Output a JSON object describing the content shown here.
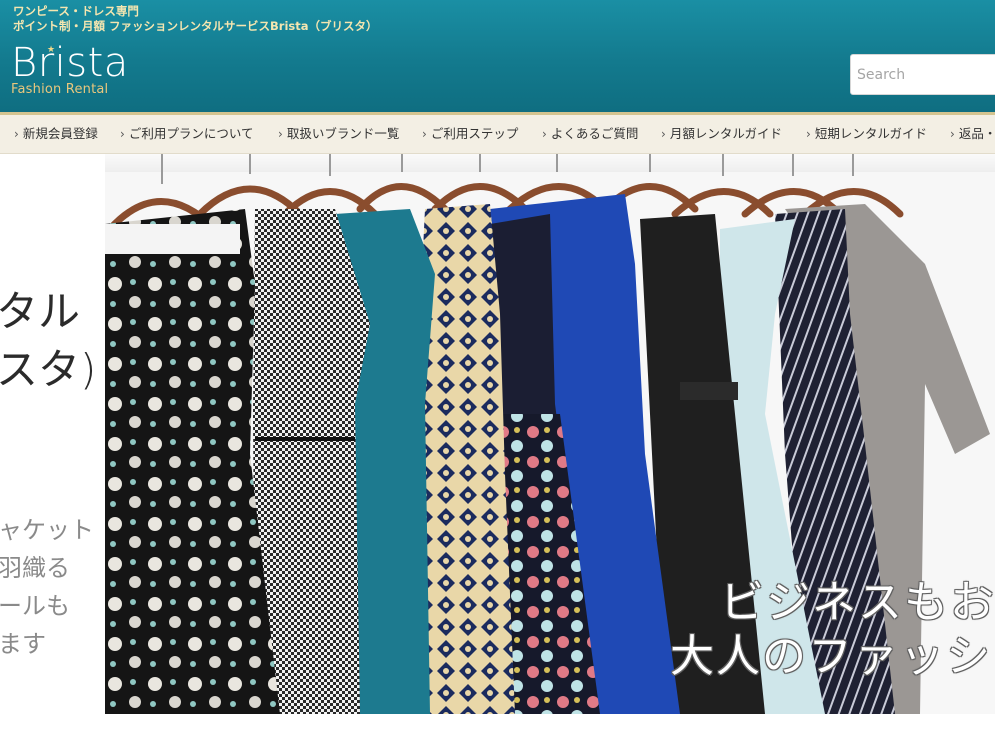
{
  "header": {
    "tagline_line1": "ワンピース・ドレス専門",
    "tagline_line2": "ポイント制・月額 ファッションレンタルサービスBrista（ブリスタ）",
    "logo_name": "Brista",
    "logo_subtitle": "Fashion Rental",
    "search_placeholder": "Search"
  },
  "nav": {
    "items": [
      {
        "label": "新規会員登録"
      },
      {
        "label": "ご利用プランについて"
      },
      {
        "label": "取扱いブランド一覧"
      },
      {
        "label": "ご利用ステップ"
      },
      {
        "label": "よくあるご質問"
      },
      {
        "label": "月額レンタルガイド"
      },
      {
        "label": "短期レンタルガイド"
      },
      {
        "label": "返品・"
      }
    ],
    "chevron": "›"
  },
  "left_copy": {
    "line1": "タル",
    "line2": "スタ)",
    "line3": "ャケット",
    "line4": "羽織る",
    "line5": "ールも",
    "line6": "ます"
  },
  "hero": {
    "overlay_line1": "ビジネスもお",
    "overlay_line2": "大人のファッシ",
    "dress_colors": [
      "#1b1b1b",
      "#e8e8e8",
      "#1d7a8f",
      "#1c2a5e",
      "#1b1e33",
      "#1f49b5",
      "#1f1f1f",
      "#cfe6ea",
      "#242638",
      "#9a9694"
    ]
  },
  "colors": {
    "header_bg": "#137a8e",
    "tagline": "#f5e6b0",
    "logo_subtitle": "#e9c77d",
    "nav_bg": "#f3efe4"
  }
}
